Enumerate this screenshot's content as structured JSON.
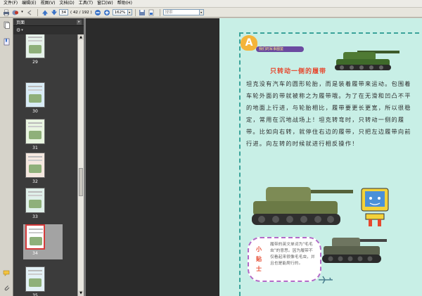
{
  "menu": [
    "文件(F)",
    "编辑(E)",
    "视图(V)",
    "文档(D)",
    "工具(T)",
    "窗口(W)",
    "帮助(H)"
  ],
  "toolbar": {
    "page_current": "34",
    "page_total": "( 42 / 192 )",
    "zoom": "162%",
    "search_placeholder": "搜索"
  },
  "panel": {
    "title": "页面"
  },
  "thumbnails": [
    {
      "label": "29"
    },
    {
      "label": "30"
    },
    {
      "label": "31"
    },
    {
      "label": "32"
    },
    {
      "label": "33"
    },
    {
      "label": "34",
      "selected": true
    },
    {
      "label": "35"
    }
  ],
  "pdf": {
    "badge_letter": "A",
    "badge_bar": "我们的军事图鉴",
    "title": "只转动一侧的履带",
    "paragraph": "坦克没有汽车的圆形轮胎，而是装着履带来运动。包围着车轮外面的带就被称之为履带哦。为了在无滑和凹凸不平的地面上行进，与轮胎相比，履带要更长更宽，所以很稳定，常用在沉地战场上！坦克转弯时，只转动一侧的履带。比如向右转，就停住右边的履带，只把左边履带向前行进。向左转的时候就进行相反操作！",
    "tip_tag": "小贴士",
    "tip_text": "履带的英文单词为\"毛毛虫\"的意思。因为履带不仅看起来很像毛毛虫，并且也是能爬行的。"
  },
  "colors": {
    "accent_red": "#e6482e",
    "page_bg": "#c8efe6",
    "selection_border": "#d43a3a"
  }
}
